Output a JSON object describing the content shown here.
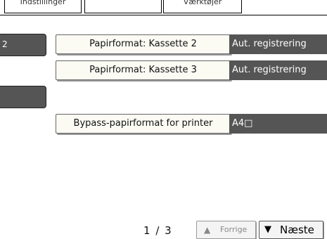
{
  "tabs": [
    {
      "label": "Indstillinger"
    },
    {
      "label": ""
    },
    {
      "label": "Værktøjer"
    }
  ],
  "left_buttons": [
    {
      "label": "2"
    },
    {
      "label": ""
    }
  ],
  "settings": [
    {
      "label": "Papirformat: Kassette 2",
      "value": "Aut. registrering"
    },
    {
      "label": "Papirformat: Kassette 3",
      "value": "Aut. registrering"
    },
    {
      "label": "Bypass-papirformat for printer",
      "value": "A4□"
    }
  ],
  "pagination": {
    "current": "1",
    "separator": "∕",
    "total": "3",
    "prev_label": "Forrige",
    "next_label": "Næste",
    "prev_icon": "▲",
    "next_icon": "▼"
  }
}
